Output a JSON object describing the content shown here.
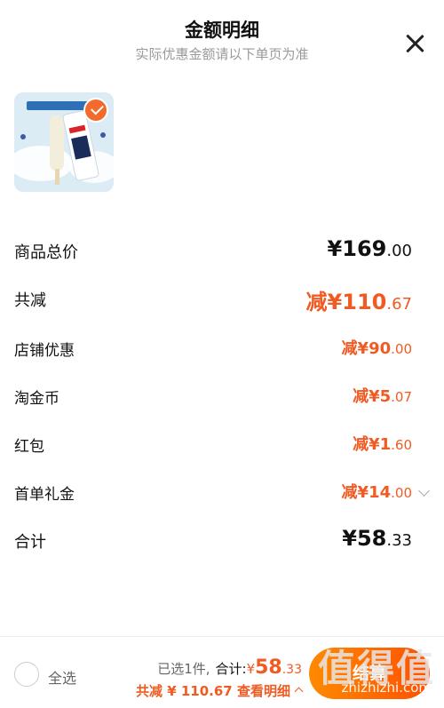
{
  "header": {
    "title": "金额明细",
    "subtitle": "实际优惠金额请以下单页为准"
  },
  "product": {
    "image_alt": "大白兔雪糕",
    "selected": true
  },
  "rows": {
    "goods_total": {
      "label": "商品总价",
      "currency": "¥",
      "main": "169",
      "dec": ".00"
    },
    "total_reduce": {
      "label": "共减",
      "prefix": "减",
      "currency": "¥",
      "main": "110",
      "dec": ".67"
    },
    "store_discount": {
      "label": "店铺优惠",
      "prefix": "减",
      "currency": "¥",
      "main": "90",
      "dec": ".00"
    },
    "taojinbi": {
      "label": "淘金币",
      "prefix": "减",
      "currency": "¥",
      "main": "5",
      "dec": ".07"
    },
    "hongbao": {
      "label": "红包",
      "prefix": "减",
      "currency": "¥",
      "main": "1",
      "dec": ".60"
    },
    "first_order_gift": {
      "label": "首单礼金",
      "prefix": "减",
      "currency": "¥",
      "main": "14",
      "dec": ".00"
    },
    "sum": {
      "label": "合计",
      "currency": "¥",
      "main": "58",
      "dec": ".33"
    }
  },
  "bottom": {
    "select_all": "全选",
    "selected_count": "已选1件,",
    "total_label": "合计:",
    "total_currency": "¥",
    "total_main": "58",
    "total_dec": ".33",
    "discount_text": "共减 ¥ 110.67",
    "view_detail": "查看明细",
    "checkout_label": "结算",
    "watermark": "值得值",
    "watermark_url": "zhizhizhi.com"
  },
  "colors": {
    "accent": "#f05a23",
    "checkout_start": "#ff8a00",
    "checkout_end": "#ff5000"
  }
}
